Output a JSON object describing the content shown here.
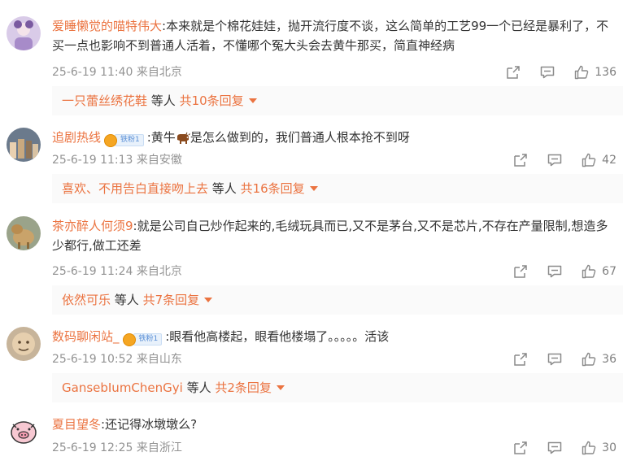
{
  "comments": [
    {
      "username": "爱睡懒觉的喵特伟大",
      "text": ":本来就是个棉花娃娃，抛开流行度不谈，这么简单的工艺99一个已经是暴利了，不买一点也影响不到普通人活着，不懂哪个冤大头会去黄牛那买，简直神经病",
      "time": "25-6-19 11:40",
      "location": "来自北京",
      "likes": "136",
      "reply_name": "一只蕾丝绣花鞋",
      "reply_etc": " 等人 ",
      "reply_count": "共10条回复"
    },
    {
      "username": "追剧热线",
      "badge": "铁粉1",
      "text_a": ":黄牛",
      "text_b": "是怎么做到的，我们普通人根本抢不到呀",
      "emoji_icon": "cow-emoji",
      "time": "25-6-19 11:13",
      "location": "来自安徽",
      "likes": "42",
      "reply_name": "喜欢、不用告白直接吻上去",
      "reply_etc": " 等人 ",
      "reply_count": "共16条回复"
    },
    {
      "username": "茶亦醉人何须9",
      "text": ":就是公司自己炒作起来的,毛绒玩具而已,又不是茅台,又不是芯片,不存在产量限制,想造多少都行,做工还差",
      "time": "25-6-19 11:24",
      "location": "来自北京",
      "likes": "67",
      "reply_name": "依然可乐",
      "reply_etc": " 等人 ",
      "reply_count": "共7条回复"
    },
    {
      "username": "数码聊闲站_",
      "badge": "铁粉1",
      "text": ":眼看他高楼起，眼看他楼塌了。。。。。活该",
      "time": "25-6-19 10:52",
      "location": "来自山东",
      "likes": "36",
      "reply_name": "GansebIumChenGyi",
      "reply_etc": " 等人 ",
      "reply_count": "共2条回复"
    },
    {
      "username": "夏目望冬",
      "text": ":还记得冰墩墩么?",
      "time": "25-6-19 12:25",
      "location": "来自浙江",
      "likes": "30"
    }
  ],
  "colors": {
    "username": "#eb7340",
    "meta": "#939393",
    "reply_bg": "#fafafa"
  },
  "icons": [
    "share-icon",
    "comment-icon",
    "like-icon",
    "caret-down-icon"
  ]
}
